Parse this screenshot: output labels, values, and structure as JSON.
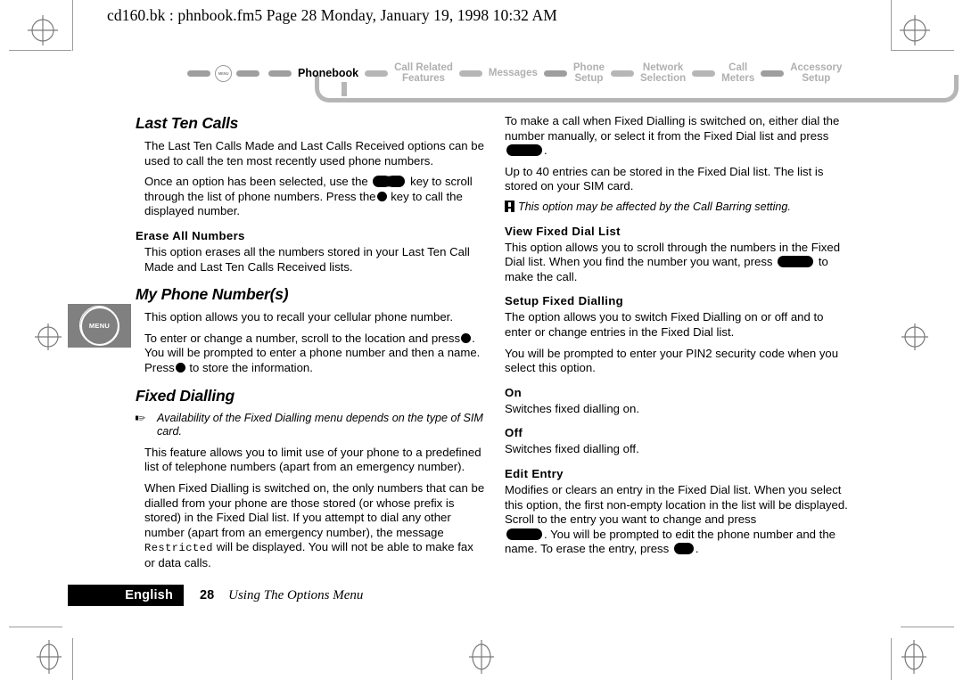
{
  "header": {
    "text": "cd160.bk : phnbook.fm5  Page 28  Monday, January 19, 1998  10:32 AM"
  },
  "nav": {
    "start_icon": "menu-key-icon",
    "items": [
      {
        "label": "Phonebook",
        "active": true
      },
      {
        "label": "Call Related\nFeatures",
        "active": false
      },
      {
        "label": "Messages",
        "active": false
      },
      {
        "label": "Phone\nSetup",
        "active": false
      },
      {
        "label": "Network\nSelection",
        "active": false
      },
      {
        "label": "Call\nMeters",
        "active": false
      },
      {
        "label": "Accessory\nSetup",
        "active": false
      }
    ]
  },
  "margin_icon": {
    "label": "MENU"
  },
  "left_column": {
    "heading_last_ten_calls": "Last Ten Calls",
    "p1": "The Last Ten Calls Made and Last Calls Received options can be used to call the ten most recently used phone numbers.",
    "p2_a": "Once an option has been selected, use the",
    "p2_b": "key to scroll through the list of phone numbers. Press the",
    "p2_c": "key to call the displayed number.",
    "sub_erase_all": "Erase All Numbers",
    "p3": "This option erases all the numbers stored in your Last Ten Call Made and Last Ten Calls Received lists.",
    "heading_my_phone_number": "My Phone Number(s)",
    "p4": "This option allows you to recall your cellular phone number.",
    "p5_a": "To enter or change a number, scroll to the location and press",
    "p5_b": ". You will be prompted to enter a phone number and then a name. Press",
    "p5_c": "to store the information.",
    "heading_fixed_dialling": "Fixed Dialling",
    "note1": "Availability of the Fixed Dialling menu depends on the type of SIM card.",
    "p6": "This feature allows you to limit use of your phone to a predefined list of telephone numbers (apart from an emergency number).",
    "p7_a": "When Fixed Dialling is switched on, the only numbers that can be dialled from your phone are those stored (or whose prefix is stored) in the Fixed Dial list. If you attempt to dial any other number (apart from an emergency number), the message",
    "p7_mono": "Restricted",
    "p7_b": "will be displayed. You will not be able to make fax or data calls."
  },
  "right_column": {
    "p1_a": "To make a call when Fixed Dialling is switched on, either dial the number manually, or select it from the Fixed Dial list and press",
    "p1_b": ".",
    "p2": "Up to 40 entries can be stored in the Fixed Dial list. The list is stored on your SIM card.",
    "note1": "This option may be affected by the Call Barring setting.",
    "sub_view_list": "View Fixed Dial List",
    "p3_a": "This option allows you to scroll through the numbers in the Fixed Dial list. When you find the number you want, press",
    "p3_b": "to make the call.",
    "sub_setup": "Setup Fixed Dialling",
    "p4": "The option allows you to switch Fixed Dialling on or off and to enter or change entries in the Fixed Dial list.",
    "p5": "You will be prompted to enter your PIN2 security code when you select this option.",
    "sub_on": "On",
    "p6": "Switches fixed dialling on.",
    "sub_off": "Off",
    "p7": "Switches fixed dialling off.",
    "sub_edit_entry": "Edit Entry",
    "p8_a": "Modifies or clears an entry in the Fixed Dial list. When you select this option, the first non-empty location in the list will be displayed. Scroll to the entry you want to change and press",
    "p8_b": ". You will be prompted to edit the phone number and the name. To erase the entry, press",
    "p8_c": "."
  },
  "footer": {
    "language": "English",
    "page_number": "28",
    "section_title": "Using The Options Menu"
  },
  "colors": {
    "nav_inactive": "#b0b0b0",
    "nav_active": "#000000",
    "nav_pipe": "#b6b6b6",
    "margin_icon_bg": "#808080",
    "reg_mark": "#7a7a7a"
  }
}
